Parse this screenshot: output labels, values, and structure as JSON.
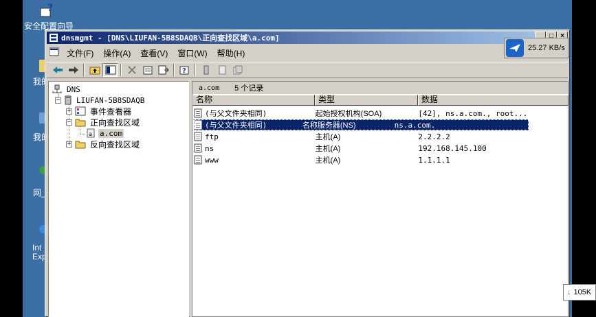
{
  "desktop": {
    "icons": [
      {
        "label": "安全配置向导"
      },
      {
        "label": "我的"
      },
      {
        "label": "我的"
      },
      {
        "label": "网_"
      },
      {
        "label": "Int"
      },
      {
        "label": "Exp"
      }
    ]
  },
  "window": {
    "title": "dnsmgmt - [DNS\\LIUFAN-5B8SDAQB\\正向查找区域\\a.com]",
    "buttons": {
      "minimize": "_",
      "restore": "□",
      "close": "×"
    }
  },
  "menu": {
    "items": [
      "文件(F)",
      "操作(A)",
      "查看(V)",
      "窗口(W)",
      "帮助(H)"
    ]
  },
  "speed_widget": {
    "speed": "25.27 KB/s"
  },
  "download_widget": {
    "label": "105K"
  },
  "tree": {
    "root": "DNS",
    "server": "LIUFAN-5B8SDAQB",
    "event_viewer": "事件查看器",
    "forward_zones": "正向查找区域",
    "zone": "a.com",
    "reverse_zones": "反向查找区域"
  },
  "list": {
    "caption_zone": "a.com",
    "caption_count": "5 个记录",
    "columns": [
      "名称",
      "类型",
      "数据"
    ],
    "rows": [
      {
        "name": "(与父文件夹相同)",
        "type": "起始授权机构(SOA)",
        "data": "[42], ns.a.com., root..."
      },
      {
        "name": "(与父文件夹相同)",
        "type": "名称服务器(NS)",
        "data": "ns.a.com."
      },
      {
        "name": "ftp",
        "type": "主机(A)",
        "data": "2.2.2.2"
      },
      {
        "name": "ns",
        "type": "主机(A)",
        "data": "192.168.145.100"
      },
      {
        "name": "www",
        "type": "主机(A)",
        "data": "1.1.1.1"
      }
    ],
    "selected_row": 1
  },
  "colors": {
    "desktop": "#3a6ea5",
    "title_start": "#0a246a",
    "title_end": "#a6caf0",
    "selection": "#0a246a",
    "chrome": "#d4d0c8"
  }
}
